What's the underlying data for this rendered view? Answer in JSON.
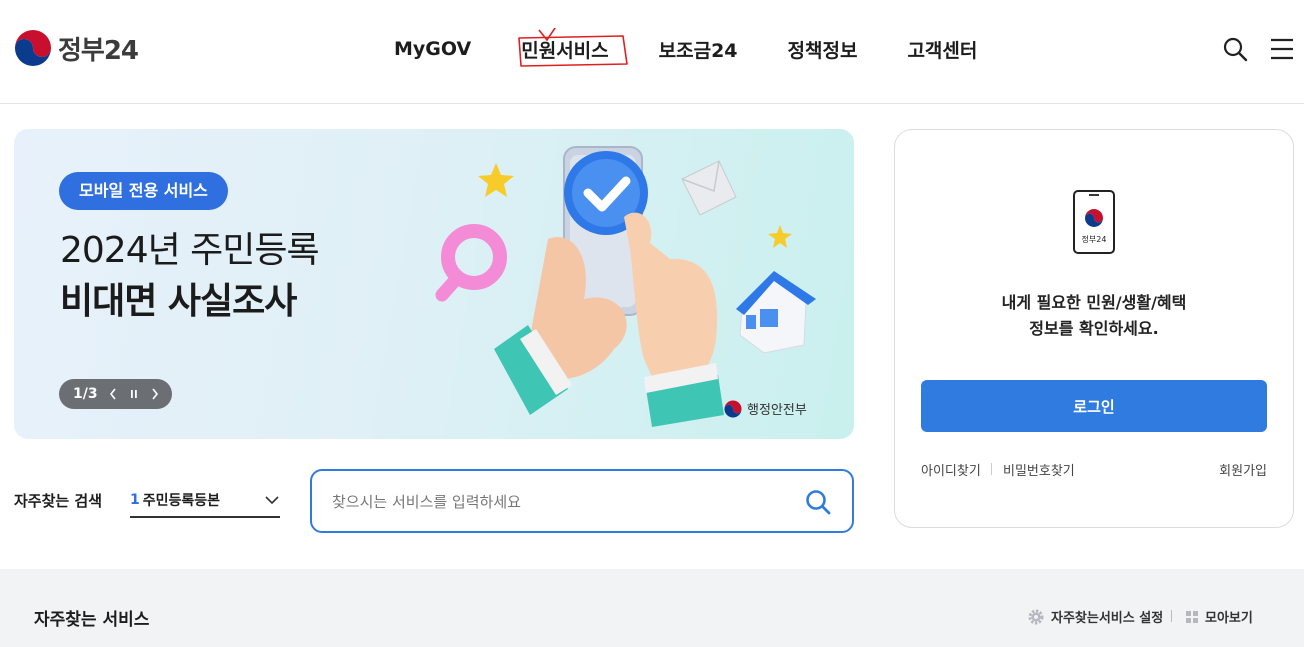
{
  "header": {
    "logo_text": "정부24",
    "nav": [
      "MyGOV",
      "민원서비스",
      "보조금24",
      "정책정보",
      "고객센터"
    ],
    "highlighted_nav": "민원서비스",
    "icons": [
      "search-icon",
      "hamburger-menu-icon"
    ]
  },
  "banner": {
    "badge": "모바일 전용 서비스",
    "title_line1": "2024년 주민등록",
    "title_line2": "비대면 사실조사",
    "slide_indicator": "1/3",
    "controls": [
      "chevron-left-icon",
      "pause-icon",
      "chevron-right-icon"
    ],
    "ministry": "행정안전부"
  },
  "quick_search": {
    "label": "자주찾는 검색",
    "selected_rank": "1",
    "selected_value": "주민등록등본",
    "search_placeholder": "찾으시는 서비스를 입력하세요"
  },
  "login": {
    "phone_label": "정부24",
    "message_line1": "내게 필요한 민원/생활/혜택",
    "message_line2": "정보를 확인하세요.",
    "button": "로그인",
    "find_id": "아이디찾기",
    "find_password": "비밀번호찾기",
    "signup": "회원가입"
  },
  "frequent": {
    "title": "자주찾는 서비스",
    "settings": "자주찾는서비스 설정",
    "view_all": "모아보기"
  },
  "colors": {
    "accent": "#2f7be0",
    "badge": "#2f6fe0",
    "annotation": "#e02020"
  }
}
